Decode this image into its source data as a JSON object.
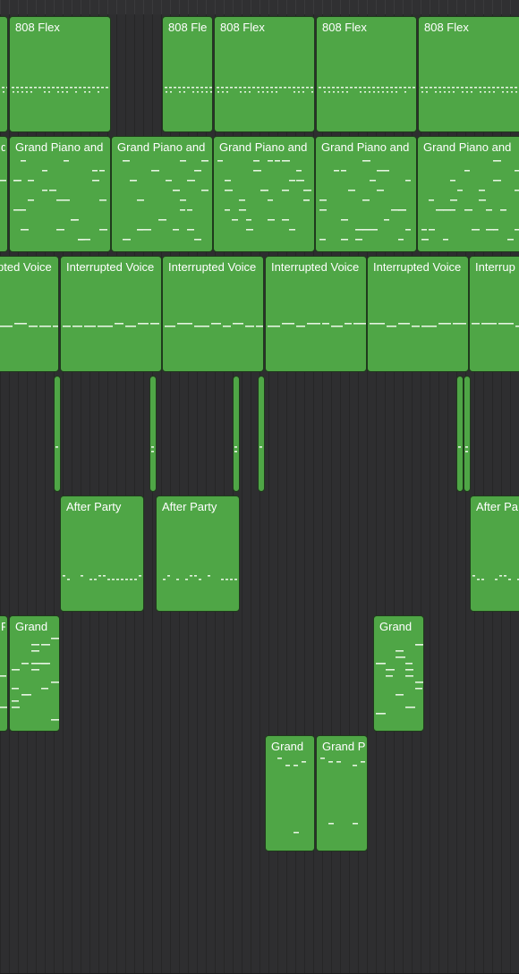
{
  "colors": {
    "region_fill": "#4fa646",
    "region_border": "#1f3a1c",
    "note_color": "#e4f3e0",
    "background": "#2b2b2c"
  },
  "tracks": [
    {
      "id": "track-808-flex",
      "pattern": "drums",
      "regions": [
        {
          "name": ""
        },
        {
          "name": "808 Flex"
        },
        {
          "name": "808 Fle"
        },
        {
          "name": "808 Flex"
        },
        {
          "name": "808 Flex"
        },
        {
          "name": "808 Flex"
        }
      ]
    },
    {
      "id": "track-grand-piano",
      "pattern": "piano",
      "regions": [
        {
          "name": "d"
        },
        {
          "name": "Grand Piano and"
        },
        {
          "name": "Grand Piano and"
        },
        {
          "name": "Grand Piano and"
        },
        {
          "name": "Grand Piano and"
        },
        {
          "name": "Grand Piano and"
        }
      ]
    },
    {
      "id": "track-interrupted-voice",
      "pattern": "voice",
      "regions": [
        {
          "name": "pted Voice"
        },
        {
          "name": "Interrupted Voice"
        },
        {
          "name": "Interrupted Voice"
        },
        {
          "name": "Interrupted Voice"
        },
        {
          "name": "Interrupted Voice"
        },
        {
          "name": "Interrup"
        }
      ]
    },
    {
      "id": "track-short-hits",
      "pattern": "hits",
      "regions": [
        {
          "name": ""
        },
        {
          "name": ""
        },
        {
          "name": ""
        },
        {
          "name": ""
        },
        {
          "name": ""
        },
        {
          "name": ""
        }
      ]
    },
    {
      "id": "track-after-party",
      "pattern": "sparse",
      "regions": [
        {
          "name": "After Party"
        },
        {
          "name": "After Party"
        },
        {
          "name": "After Pa"
        }
      ]
    },
    {
      "id": "track-grand-a",
      "pattern": "chords",
      "regions": [
        {
          "name": "P"
        },
        {
          "name": "Grand"
        },
        {
          "name": "Grand"
        }
      ]
    },
    {
      "id": "track-grand-b",
      "pattern": "bass",
      "regions": [
        {
          "name": "Grand"
        },
        {
          "name": "Grand P"
        }
      ]
    }
  ]
}
